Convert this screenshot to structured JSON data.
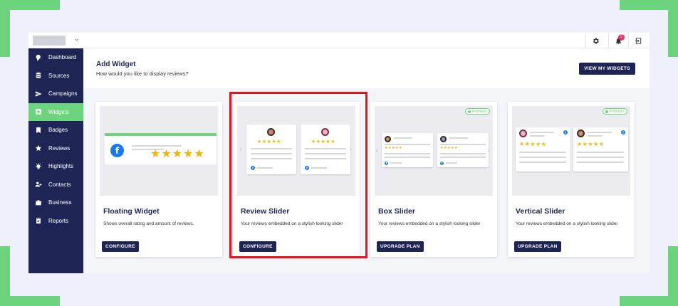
{
  "topbar": {
    "notification_count": "5"
  },
  "sidebar": {
    "items": [
      {
        "label": "Dashboard",
        "icon": "dashboard-icon"
      },
      {
        "label": "Sources",
        "icon": "database-icon"
      },
      {
        "label": "Campaigns",
        "icon": "send-icon"
      },
      {
        "label": "Widgets",
        "icon": "widget-icon",
        "active": true
      },
      {
        "label": "Badges",
        "icon": "bookmark-icon"
      },
      {
        "label": "Reviews",
        "icon": "star-icon"
      },
      {
        "label": "Highlights",
        "icon": "lightbulb-icon"
      },
      {
        "label": "Contacts",
        "icon": "contacts-icon"
      },
      {
        "label": "Business",
        "icon": "briefcase-icon"
      },
      {
        "label": "Reports",
        "icon": "clipboard-icon"
      }
    ]
  },
  "header": {
    "title": "Add Widget",
    "subtitle": "How would you like to display reviews?",
    "view_button": "VIEW MY WIDGETS"
  },
  "cards": [
    {
      "title": "Floating Widget",
      "description": "Shows overall rating and amount of reviews.",
      "button": "CONFIGURE"
    },
    {
      "title": "Review Slider",
      "description": "Your reviews embedded on a stylish looking slider",
      "button": "CONFIGURE"
    },
    {
      "title": "Box Slider",
      "description": "Your reviews embedded on a stylish looking slider",
      "button": "UPGRADE PLAN",
      "badge": "Premium"
    },
    {
      "title": "Vertical Slider",
      "description": "Your reviews embedded on a stylish looking slider",
      "button": "UPGRADE PLAN",
      "badge": "Premium"
    }
  ],
  "preview_glyphs": {
    "stars5": "★★★★★",
    "fb": "f",
    "arrow_left": "‹",
    "arrow_right": "›",
    "chevron": "⌄"
  },
  "colors": {
    "accent_green": "#6bd47c",
    "navy": "#1e2554",
    "highlight_red": "#e8131b",
    "star_gold": "#f5b400",
    "facebook_blue": "#1877f2"
  }
}
